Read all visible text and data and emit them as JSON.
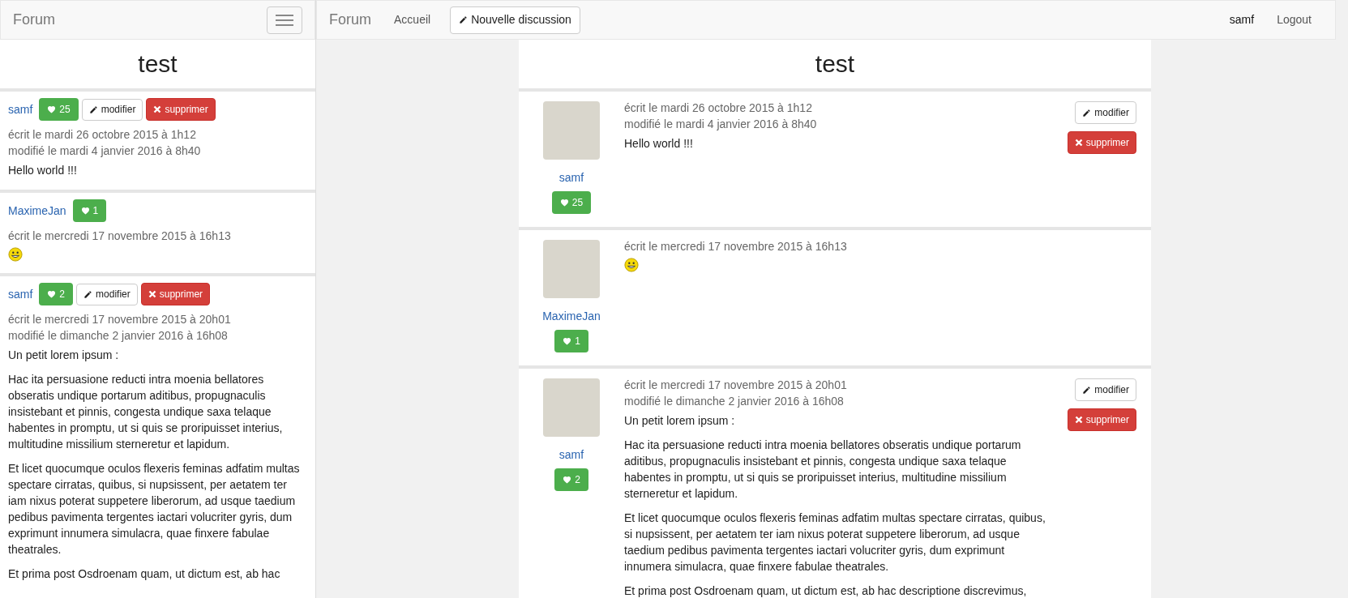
{
  "side_panel": {
    "brand": "Forum",
    "title": "test",
    "posts": [
      {
        "author": "samf",
        "likes": "25",
        "actions": [
          {
            "kind": "edit",
            "label": "modifier"
          },
          {
            "kind": "delete",
            "label": "supprimer"
          }
        ],
        "written": "écrit le mardi 26 octobre 2015 à 1h12",
        "modified": "modifié le mardi 4 janvier 2016 à 8h40",
        "content": [
          {
            "kind": "text",
            "text": "Hello world !!!"
          }
        ]
      },
      {
        "author": "MaximeJan",
        "likes": "1",
        "written": "écrit le mercredi 17 novembre 2015 à 16h13",
        "content": [
          {
            "kind": "smiley"
          }
        ]
      },
      {
        "author": "samf",
        "likes": "2",
        "actions": [
          {
            "kind": "edit",
            "label": "modifier"
          },
          {
            "kind": "delete",
            "label": "supprimer"
          }
        ],
        "written": "écrit le mercredi 17 novembre 2015 à 20h01",
        "modified": "modifié le dimanche 2 janvier 2016 à 16h08",
        "content": [
          {
            "kind": "text",
            "text": "Un petit lorem ipsum :"
          },
          {
            "kind": "text",
            "text": "Hac ita persuasione reducti intra moenia bellatores obseratis undique portarum aditibus, propugnaculis insistebant et pinnis, congesta undique saxa telaque habentes in promptu, ut si quis se proripuisset interius, multitudine missilium sterneretur et lapidum."
          },
          {
            "kind": "text",
            "text": "Et licet quocumque oculos flexeris feminas adfatim multas spectare cirratas, quibus, si nupsissent, per aetatem ter iam nixus poterat suppetere liberorum, ad usque taedium pedibus pavimenta tergentes iactari volucriter gyris, dum exprimunt innumera simulacra, quae finxere fabulae theatrales."
          },
          {
            "kind": "text",
            "text": "Et prima post Osdroenam quam, ut dictum est, ab hac"
          }
        ]
      }
    ]
  },
  "navbar": {
    "brand": "Forum",
    "links": [
      {
        "kind": "link",
        "label": "Accueil"
      },
      {
        "kind": "button",
        "label": "Nouvelle discussion"
      }
    ],
    "user": "samf",
    "logout": "Logout"
  },
  "main": {
    "title": "test",
    "posts": [
      {
        "author": "samf",
        "likes": "25",
        "actions": [
          {
            "kind": "edit",
            "label": "modifier"
          },
          {
            "kind": "delete",
            "label": "supprimer"
          }
        ],
        "written": "écrit le mardi 26 octobre 2015 à 1h12",
        "modified": "modifié le mardi 4 janvier 2016 à 8h40",
        "content": [
          {
            "kind": "text",
            "text": "Hello world !!!"
          }
        ]
      },
      {
        "author": "MaximeJan",
        "likes": "1",
        "written": "écrit le mercredi 17 novembre 2015 à 16h13",
        "content": [
          {
            "kind": "smiley"
          }
        ]
      },
      {
        "author": "samf",
        "likes": "2",
        "actions": [
          {
            "kind": "edit",
            "label": "modifier"
          },
          {
            "kind": "delete",
            "label": "supprimer"
          }
        ],
        "written": "écrit le mercredi 17 novembre 2015 à 20h01",
        "modified": "modifié le dimanche 2 janvier 2016 à 16h08",
        "content": [
          {
            "kind": "text",
            "text": "Un petit lorem ipsum :"
          },
          {
            "kind": "text",
            "text": "Hac ita persuasione reducti intra moenia bellatores obseratis undique portarum aditibus, propugnaculis insistebant et pinnis, congesta undique saxa telaque habentes in promptu, ut si quis se proripuisset interius, multitudine missilium sterneretur et lapidum."
          },
          {
            "kind": "text",
            "text": "Et licet quocumque oculos flexeris feminas adfatim multas spectare cirratas, quibus, si nupsissent, per aetatem ter iam nixus poterat suppetere liberorum, ad usque taedium pedibus pavimenta tergentes iactari volucriter gyris, dum exprimunt innumera simulacra, quae finxere fabulae theatrales."
          },
          {
            "kind": "text",
            "text": "Et prima post Osdroenam quam, ut dictum est, ab hac descriptione discrevimus,"
          }
        ]
      }
    ]
  }
}
